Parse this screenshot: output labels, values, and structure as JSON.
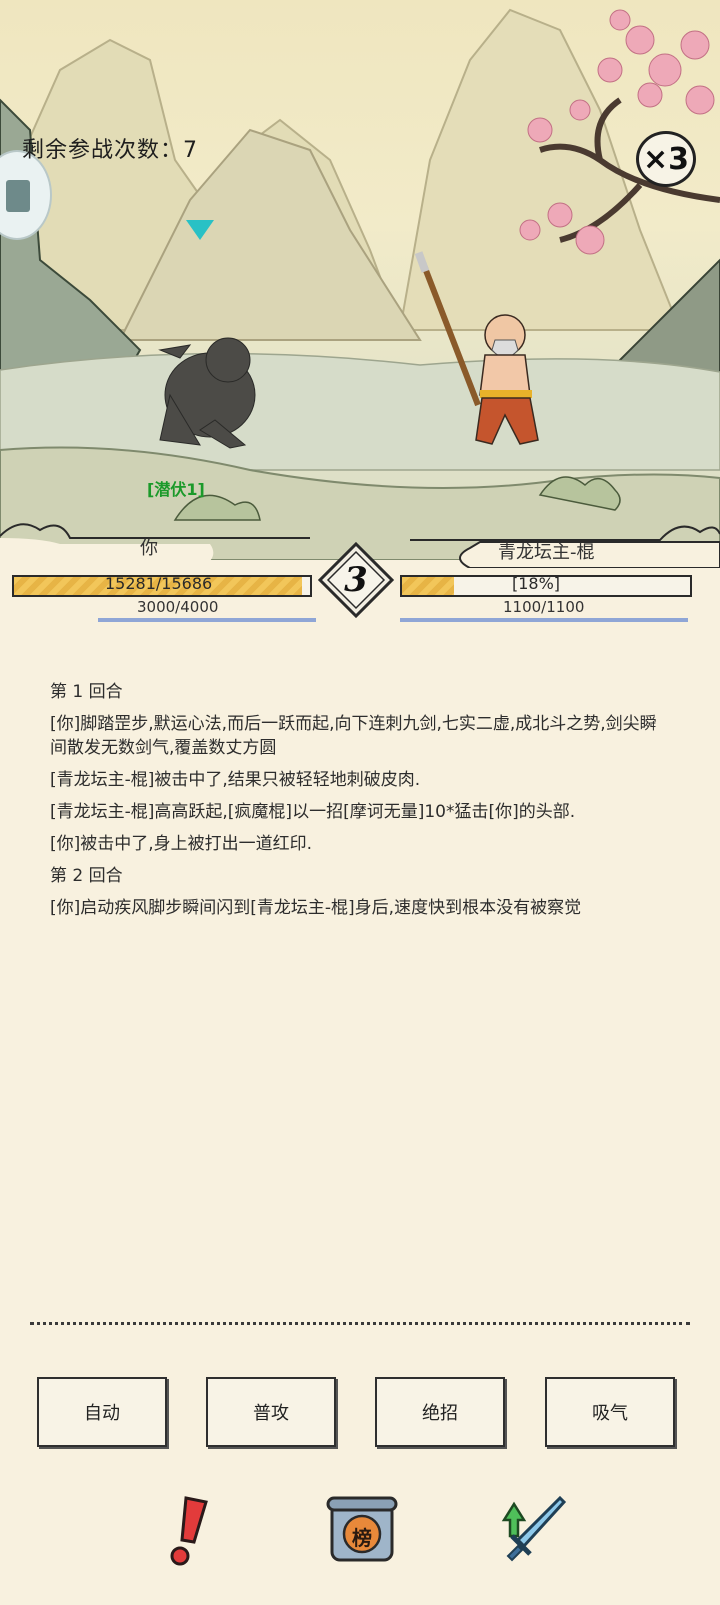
{
  "scene": {
    "remaining_label": "剩余参战次数：",
    "remaining_count": "7",
    "speed_label": "×3",
    "stealth_tag": "[潜伏1]"
  },
  "player": {
    "name": "你",
    "hp_text": "15281/15686",
    "hp_fraction": 0.974,
    "mp_text": "3000/4000"
  },
  "enemy": {
    "name": "青龙坛主-棍",
    "hp_text": "[18%]",
    "hp_fraction": 0.18,
    "mp_text": "1100/1100"
  },
  "round_number": "3",
  "log": [
    "第 1 回合",
    "[你]脚踏罡步,默运心法,而后一跃而起,向下连刺九剑,七实二虚,成北斗之势,剑尖瞬间散发无数剑气,覆盖数丈方圆",
    "[青龙坛主-棍]被击中了,结果只被轻轻地刺破皮肉.",
    "[青龙坛主-棍]高高跃起,[疯魔棍]以一招[摩诃无量]10*猛击[你]的头部.",
    "[你]被击中了,身上被打出一道红印.",
    "第 2 回合",
    "[你]启动疾风脚步瞬间闪到[青龙坛主-棍]身后,速度快到根本没有被察觉"
  ],
  "buttons": {
    "auto": "自动",
    "normal_attack": "普攻",
    "ultimate": "绝招",
    "absorb": "吸气"
  },
  "icons": {
    "alert": "exclamation-icon",
    "ranking": "榜",
    "upgrade": "sword-upgrade-icon"
  }
}
